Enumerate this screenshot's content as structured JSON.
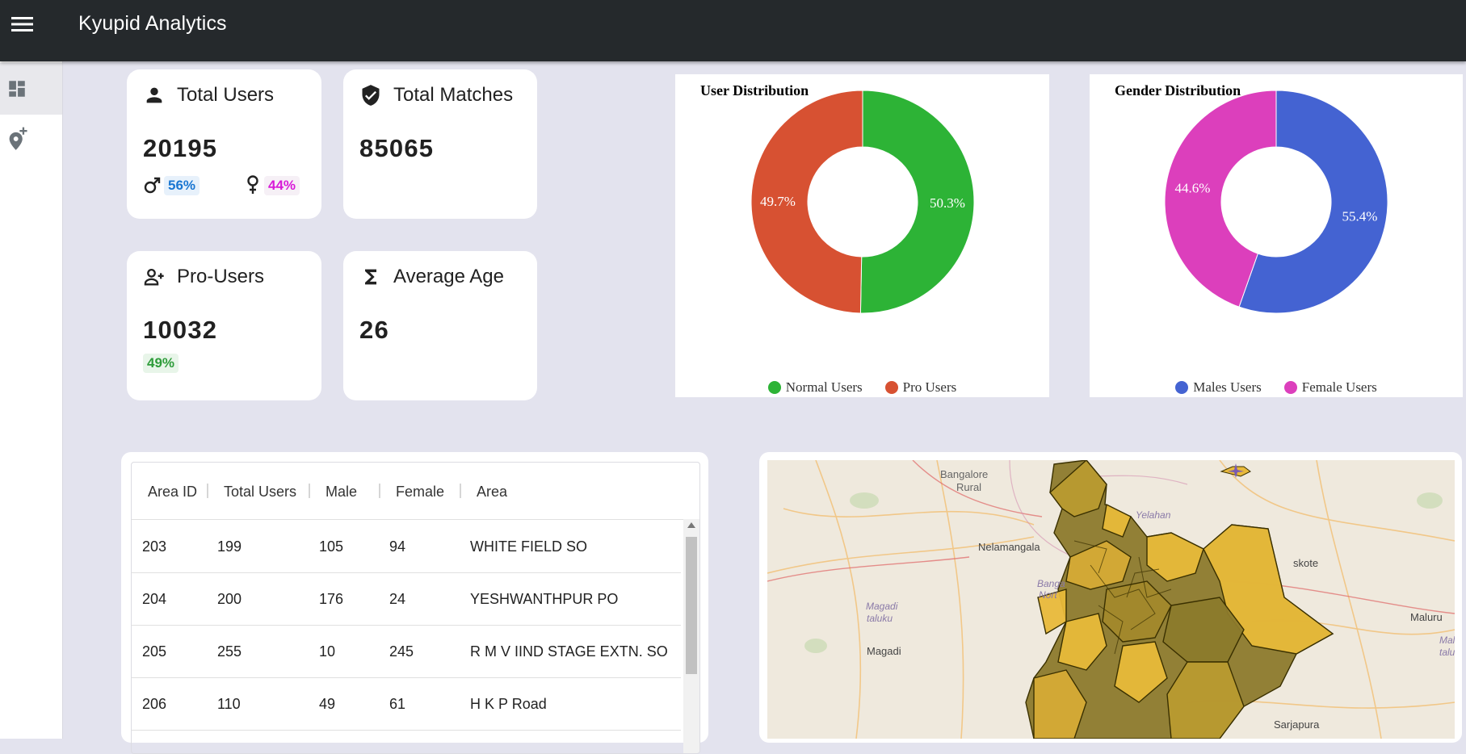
{
  "app": {
    "title": "Kyupid Analytics"
  },
  "sidebar": {
    "items": [
      {
        "icon": "dashboard-icon",
        "active": true
      },
      {
        "icon": "add-location-icon",
        "active": false
      }
    ]
  },
  "stats": {
    "total_users": {
      "title": "Total Users",
      "value": "20195",
      "male_pct": "56%",
      "female_pct": "44%"
    },
    "total_matches": {
      "title": "Total Matches",
      "value": "85065"
    },
    "pro_users": {
      "title": "Pro-Users",
      "value": "10032",
      "pct": "49%"
    },
    "average_age": {
      "title": "Average Age",
      "value": "26"
    }
  },
  "colors": {
    "normal_users": "#2db336",
    "pro_users": "#d75132",
    "males": "#4463d2",
    "females": "#dc3fbc",
    "male_chip_text": "#1976d2",
    "female_chip_text": "#d81bd8",
    "pro_chip_text": "#2e9c3a"
  },
  "chart_data": [
    {
      "type": "pie",
      "title": "User Distribution",
      "categories": [
        "Normal Users",
        "Pro Users"
      ],
      "values": [
        50.3,
        49.7
      ],
      "labels": [
        "50.3%",
        "49.7%"
      ],
      "legend_position": "bottom",
      "donut": true
    },
    {
      "type": "pie",
      "title": "Gender Distribution",
      "categories": [
        "Males Users",
        "Female Users"
      ],
      "values": [
        55.4,
        44.6
      ],
      "labels": [
        "55.4%",
        "44.6%"
      ],
      "legend_position": "bottom",
      "donut": true
    }
  ],
  "table": {
    "columns": [
      "Area ID",
      "Total Users",
      "Male",
      "Female",
      "Area"
    ],
    "rows": [
      [
        "203",
        "199",
        "105",
        "94",
        "WHITE FIELD SO"
      ],
      [
        "204",
        "200",
        "176",
        "24",
        "YESHWANTHPUR PO"
      ],
      [
        "205",
        "255",
        "10",
        "245",
        "R M V IIND STAGE EXTN. SO"
      ],
      [
        "206",
        "110",
        "49",
        "61",
        "H K P Road"
      ]
    ]
  },
  "map": {
    "labels": {
      "bangalore_rural_1": "Bangalore",
      "bangalore_rural_2": "Rural",
      "nelamangala": "Nelamangala",
      "yelahanka": "Yelahan",
      "bangalore_north_1": "Banga",
      "bangalore_north_2": "Nort",
      "magadi_taluku_1": "Magadi",
      "magadi_taluku_2": "taluku",
      "magadi": "Magadi",
      "hoskote": "skote",
      "maluru": "Maluru",
      "malur_taluk_1": "Mal",
      "malur_taluk_2": "talu",
      "sarjapura": "Sarjapura"
    }
  }
}
